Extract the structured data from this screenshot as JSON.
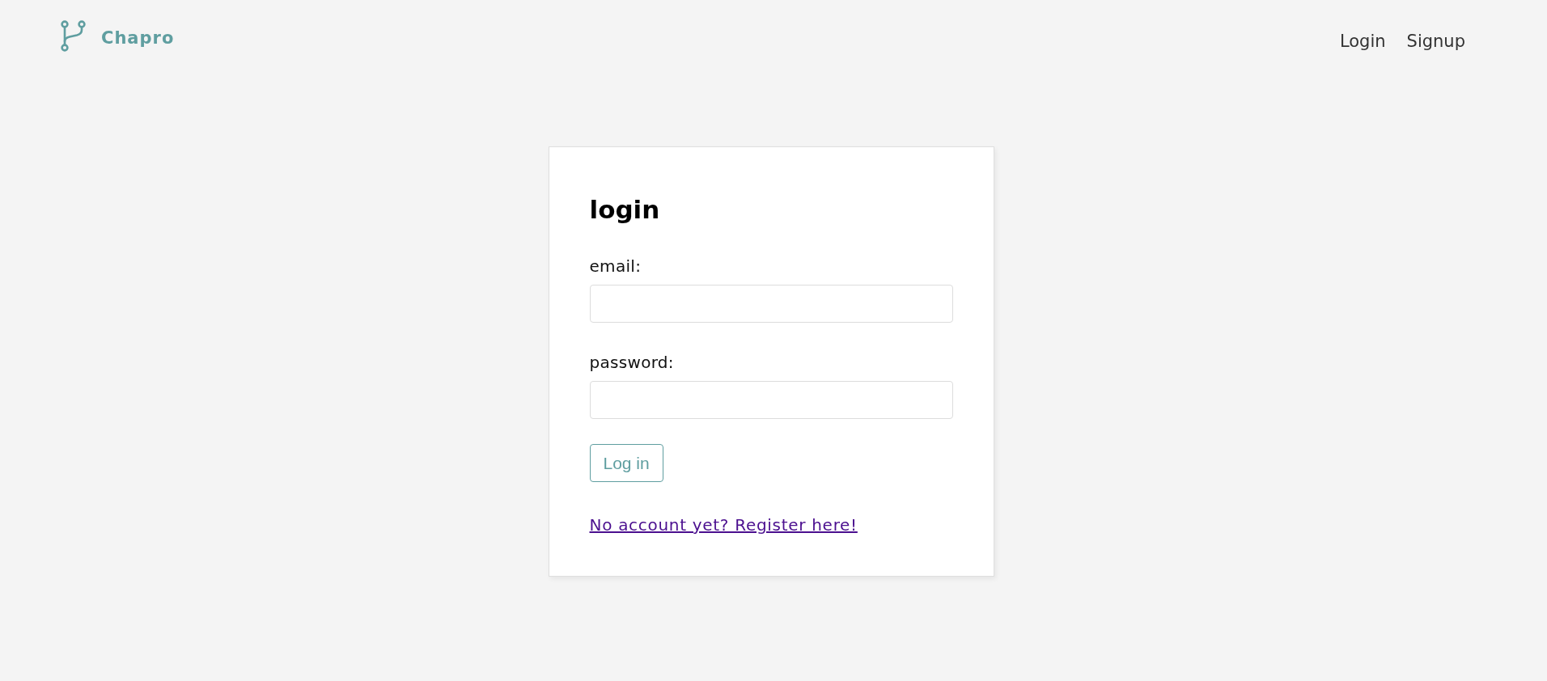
{
  "header": {
    "logo": {
      "text": "Chapro"
    },
    "nav": [
      {
        "label": "Login"
      },
      {
        "label": "Signup"
      }
    ]
  },
  "form": {
    "title": "login",
    "fields": [
      {
        "label": "email:"
      },
      {
        "label": "password:"
      }
    ],
    "submit": "Log in",
    "link": "No account yet? Register here!"
  }
}
